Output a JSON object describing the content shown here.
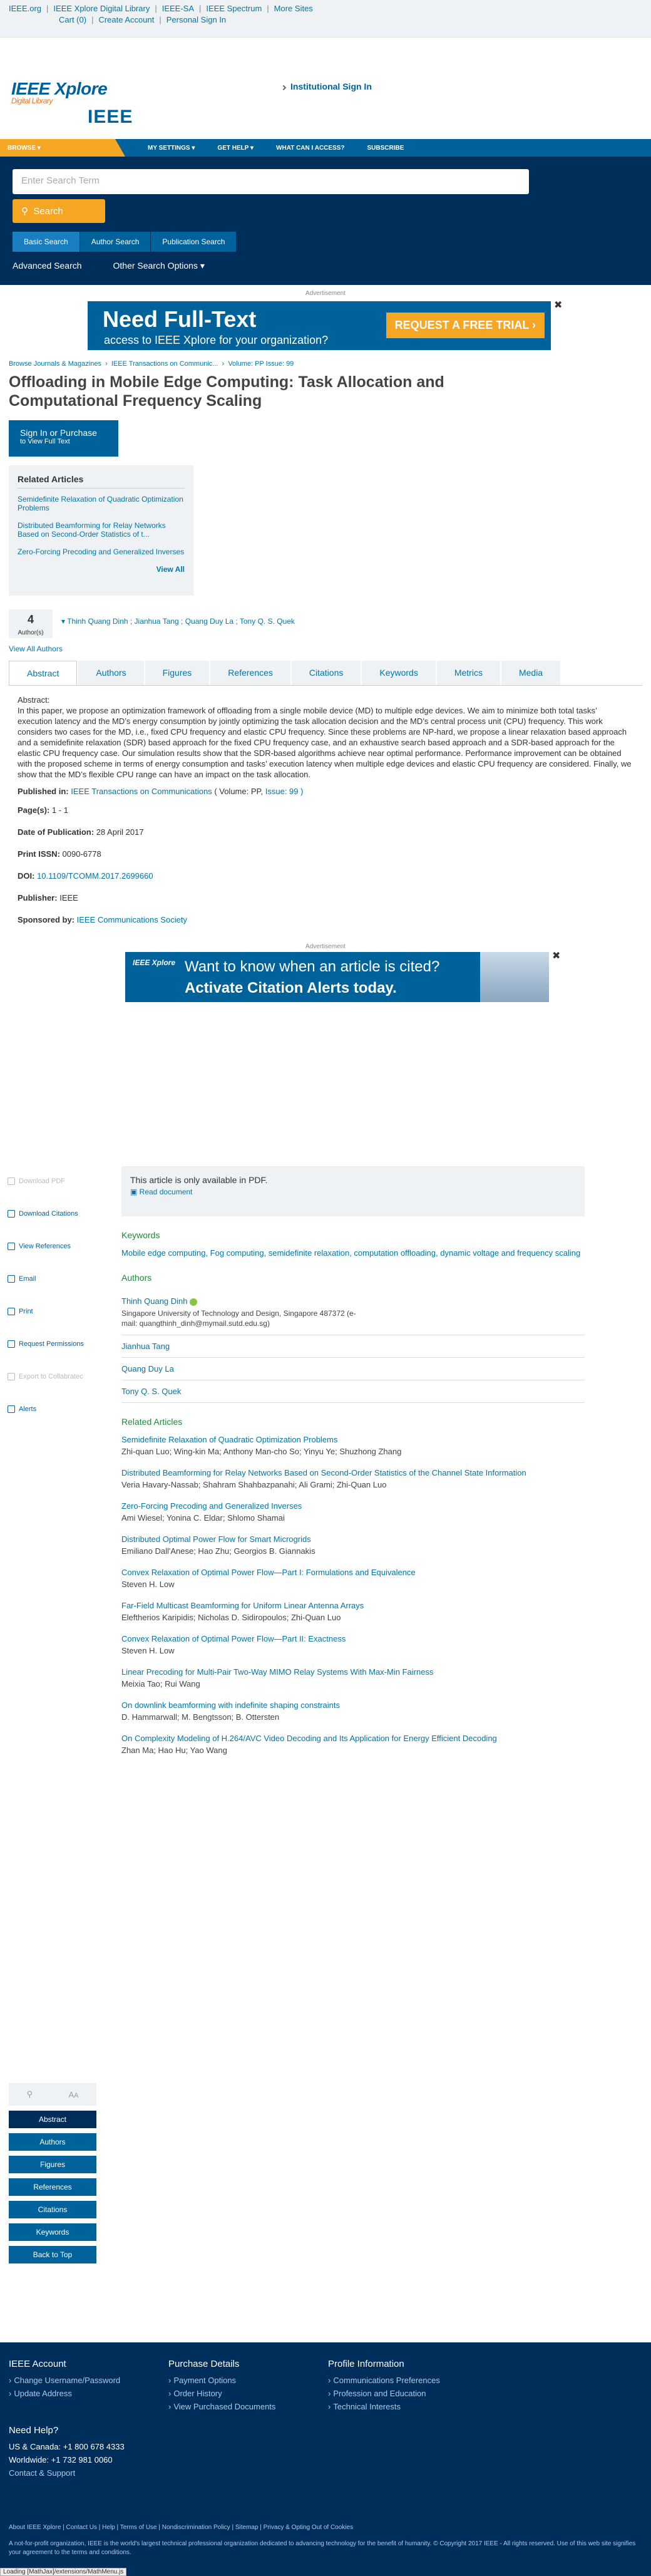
{
  "util": {
    "links": [
      "IEEE.org",
      "IEEE Xplore Digital Library",
      "IEEE-SA",
      "IEEE Spectrum",
      "More Sites"
    ],
    "cart": "Cart (0)",
    "create": "Create Account",
    "personal": "Personal Sign In"
  },
  "brand": {
    "logo": "IEEE Xplore",
    "sub": "Digital Library",
    "institutional": "Institutional Sign In",
    "ieee": "IEEE"
  },
  "nav": {
    "browse": "BROWSE",
    "items": [
      "MY SETTINGS",
      "GET HELP",
      "WHAT CAN I ACCESS?",
      "SUBSCRIBE"
    ]
  },
  "search": {
    "placeholder": "Enter Search Term",
    "button": "Search",
    "tabs": [
      "Basic Search",
      "Author Search",
      "Publication Search"
    ],
    "advanced": "Advanced Search",
    "other": "Other Search Options"
  },
  "ad1": {
    "caption": "Advertisement",
    "big": "Need Full-Text",
    "small": "access to IEEE Xplore for your organization?",
    "cta": "REQUEST A FREE TRIAL"
  },
  "breadcrumb": {
    "a": "Browse Journals & Magazines",
    "b": "IEEE Transactions on Communic...",
    "c": "Volume: PP Issue: 99"
  },
  "article": {
    "title_l1": "Offloading in Mobile Edge Computing: Task Allocation and",
    "title_l2": "Computational Frequency Scaling",
    "signin": "Sign In or Purchase",
    "signin_sub": "to View Full Text"
  },
  "related": {
    "heading": "Related Articles",
    "items": [
      "Semidefinite Relaxation of Quadratic Optimization Problems",
      "Distributed Beamforming for Relay Networks Based on Second-Order Statistics of t...",
      "Zero-Forcing Precoding and Generalized Inverses"
    ],
    "view_all": "View All"
  },
  "authors_bar": {
    "count": "4",
    "label": "Author(s)",
    "names": "Thinh Quang Dinh ; Jianhua Tang ; Quang Duy La ; Tony Q. S. Quek",
    "view_all": "View All Authors"
  },
  "tabs": [
    "Abstract",
    "Authors",
    "Figures",
    "References",
    "Citations",
    "Keywords",
    "Metrics",
    "Media"
  ],
  "abstract": {
    "heading": "Abstract:",
    "text": "In this paper, we propose an optimization framework of offloading from a single mobile device (MD) to multiple edge devices. We aim to minimize both total tasks’ execution latency and the MD’s energy consumption by jointly optimizing the task allocation decision and the MD’s central process unit (CPU) frequency. This work considers two cases for the MD, i.e., fixed CPU frequency and elastic CPU frequency. Since these problems are NP-hard, we propose a linear relaxation based approach and a semidefinite relaxation (SDR) based approach for the fixed CPU frequency case, and an exhaustive search based approach and a SDR-based approach for the elastic CPU frequency case. Our simulation results show that the SDR-based algorithms achieve near optimal performance. Performance improvement can be obtained with the proposed scheme in terms of energy consumption and tasks’ execution latency when multiple edge devices and elastic CPU frequency are considered. Finally, we show that the MD’s flexible CPU range can have an impact on the task allocation.",
    "published_label": "Published in:",
    "published": "IEEE Transactions on Communications",
    "vol": "( Volume: PP,",
    "issue": "Issue: 99 )"
  },
  "meta": {
    "pages_l": "Page(s):",
    "pages": "1 - 1",
    "date_l": "Date of Publication:",
    "date": "28 April 2017",
    "issn_l": "Print ISSN:",
    "issn": "0090-6778",
    "doi_l": "DOI:",
    "doi": "10.1109/TCOMM.2017.2699660",
    "pub_l": "Publisher:",
    "pub": "IEEE",
    "spons_l": "Sponsored by:",
    "spons": "IEEE Communications Society"
  },
  "ad2": {
    "caption": "Advertisement",
    "xp": "IEEE Xplore",
    "l1": "Want to know when an article is cited?",
    "l2": "Activate Citation Alerts today."
  },
  "side": {
    "items": [
      "Download PDF",
      "Download Citations",
      "View References",
      "Email",
      "Print",
      "Request Permissions",
      "Export to Collabratec",
      "Alerts"
    ]
  },
  "pdf": {
    "text": "This article is only available in PDF.",
    "read": "Read document"
  },
  "keywords": {
    "heading": "Keywords",
    "text": "Mobile edge computing, Fog computing, semidefinite relaxation, computation offloading, dynamic voltage and frequency scaling"
  },
  "authors": {
    "heading": "Authors",
    "list": [
      {
        "name": "Thinh Quang Dinh",
        "aff1": "Singapore University of Technology and Design, Singapore 487372 (e-",
        "aff2": "mail: quangthinh_dinh@mymail.sutd.edu.sg)"
      },
      {
        "name": "Jianhua Tang"
      },
      {
        "name": "Quang Duy La"
      },
      {
        "name": "Tony Q. S. Quek"
      }
    ]
  },
  "related_main": {
    "heading": "Related Articles",
    "items": [
      {
        "t": "Semidefinite Relaxation of Quadratic Optimization Problems",
        "a": "Zhi-quan Luo; Wing-kin Ma; Anthony Man-cho So; Yinyu Ye; Shuzhong Zhang"
      },
      {
        "t": "Distributed Beamforming for Relay Networks Based on Second-Order Statistics of the Channel State Information",
        "a": "Veria Havary-Nassab; Shahram Shahbazpanahi; Ali Grami; Zhi-Quan Luo"
      },
      {
        "t": "Zero-Forcing Precoding and Generalized Inverses",
        "a": "Ami Wiesel; Yonina C. Eldar; Shlomo Shamai"
      },
      {
        "t": "Distributed Optimal Power Flow for Smart Microgrids",
        "a": "Emiliano Dall'Anese; Hao Zhu; Georgios B. Giannakis"
      },
      {
        "t": "Convex Relaxation of Optimal Power Flow—Part I: Formulations and Equivalence",
        "a": "Steven H. Low"
      },
      {
        "t": "Far-Field Multicast Beamforming for Uniform Linear Antenna Arrays",
        "a": "Eleftherios Karipidis; Nicholas D. Sidiropoulos; Zhi-Quan Luo"
      },
      {
        "t": "Convex Relaxation of Optimal Power Flow—Part II: Exactness",
        "a": "Steven H. Low"
      },
      {
        "t": "Linear Precoding for Multi-Pair Two-Way MIMO Relay Systems With Max-Min Fairness",
        "a": "Meixia Tao; Rui Wang"
      },
      {
        "t": "On downlink beamforming with indefinite shaping constraints",
        "a": "D. Hammarwall; M. Bengtsson; B. Ottersten"
      },
      {
        "t": "On Complexity Modeling of H.264/AVC Video Decoding and Its Application for Energy Efficient Decoding",
        "a": "Zhan Ma; Hao Hu; Yao Wang"
      }
    ]
  },
  "sidenav": {
    "items": [
      "Abstract",
      "Authors",
      "Figures",
      "References",
      "Citations",
      "Keywords",
      "Back to Top"
    ]
  },
  "footer": {
    "acct": {
      "h": "IEEE Account",
      "items": [
        "Change Username/Password",
        "Update Address"
      ]
    },
    "purch": {
      "h": "Purchase Details",
      "items": [
        "Payment Options",
        "Order History",
        "View Purchased Documents"
      ]
    },
    "prof": {
      "h": "Profile Information",
      "items": [
        "Communications Preferences",
        "Profession and Education",
        "Technical Interests"
      ]
    },
    "help_h": "Need Help?",
    "us": "US & Canada: +1 800 678 4333",
    "ww": "Worldwide: +1 732 981 0060",
    "contact": "Contact & Support",
    "links": "About IEEE Xplore | Contact Us | Help | Terms of Use | Nondiscrimination Policy | Sitemap | Privacy & Opting Out of Cookies",
    "notice": "A not-for-profit organization, IEEE is the world's largest technical professional organization dedicated to advancing technology for the benefit of humanity. © Copyright 2017 IEEE - All rights reserved. Use of this web site signifies your agreement to the terms and conditions."
  },
  "loading": "Loading [MathJax]/extensions/MathMenu.js"
}
